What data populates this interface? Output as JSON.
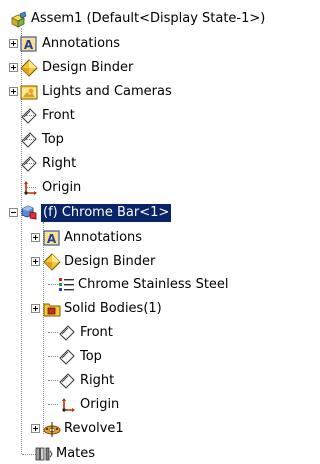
{
  "tree": {
    "root": {
      "label": "Assem1  (Default<Display State-1>)",
      "icon": "assembly-icon"
    },
    "top_items": [
      {
        "label": "Annotations",
        "icon": "annotations-icon",
        "expander": "plus"
      },
      {
        "label": "Design Binder",
        "icon": "design-binder-icon",
        "expander": "plus"
      },
      {
        "label": "Lights and Cameras",
        "icon": "lights-cameras-icon",
        "expander": "plus"
      },
      {
        "label": "Front",
        "icon": "plane-icon"
      },
      {
        "label": "Top",
        "icon": "plane-icon"
      },
      {
        "label": "Right",
        "icon": "plane-icon"
      },
      {
        "label": "Origin",
        "icon": "origin-icon"
      }
    ],
    "part": {
      "label": "(f) Chrome Bar<1>",
      "icon": "part-icon",
      "expander": "minus",
      "selected": true,
      "children": [
        {
          "label": "Annotations",
          "icon": "annotations-icon",
          "expander": "plus"
        },
        {
          "label": "Design Binder",
          "icon": "design-binder-icon",
          "expander": "plus"
        },
        {
          "label": "Chrome Stainless Steel",
          "icon": "material-icon"
        },
        {
          "label": "Solid Bodies(1)",
          "icon": "solid-bodies-icon",
          "expander": "plus"
        },
        {
          "label": "Front",
          "icon": "plane-icon"
        },
        {
          "label": "Top",
          "icon": "plane-icon"
        },
        {
          "label": "Right",
          "icon": "plane-icon"
        },
        {
          "label": "Origin",
          "icon": "origin-icon"
        },
        {
          "label": "Revolve1",
          "icon": "revolve-icon",
          "expander": "plus"
        }
      ]
    },
    "mates": {
      "label": "Mates",
      "icon": "mates-icon"
    }
  }
}
